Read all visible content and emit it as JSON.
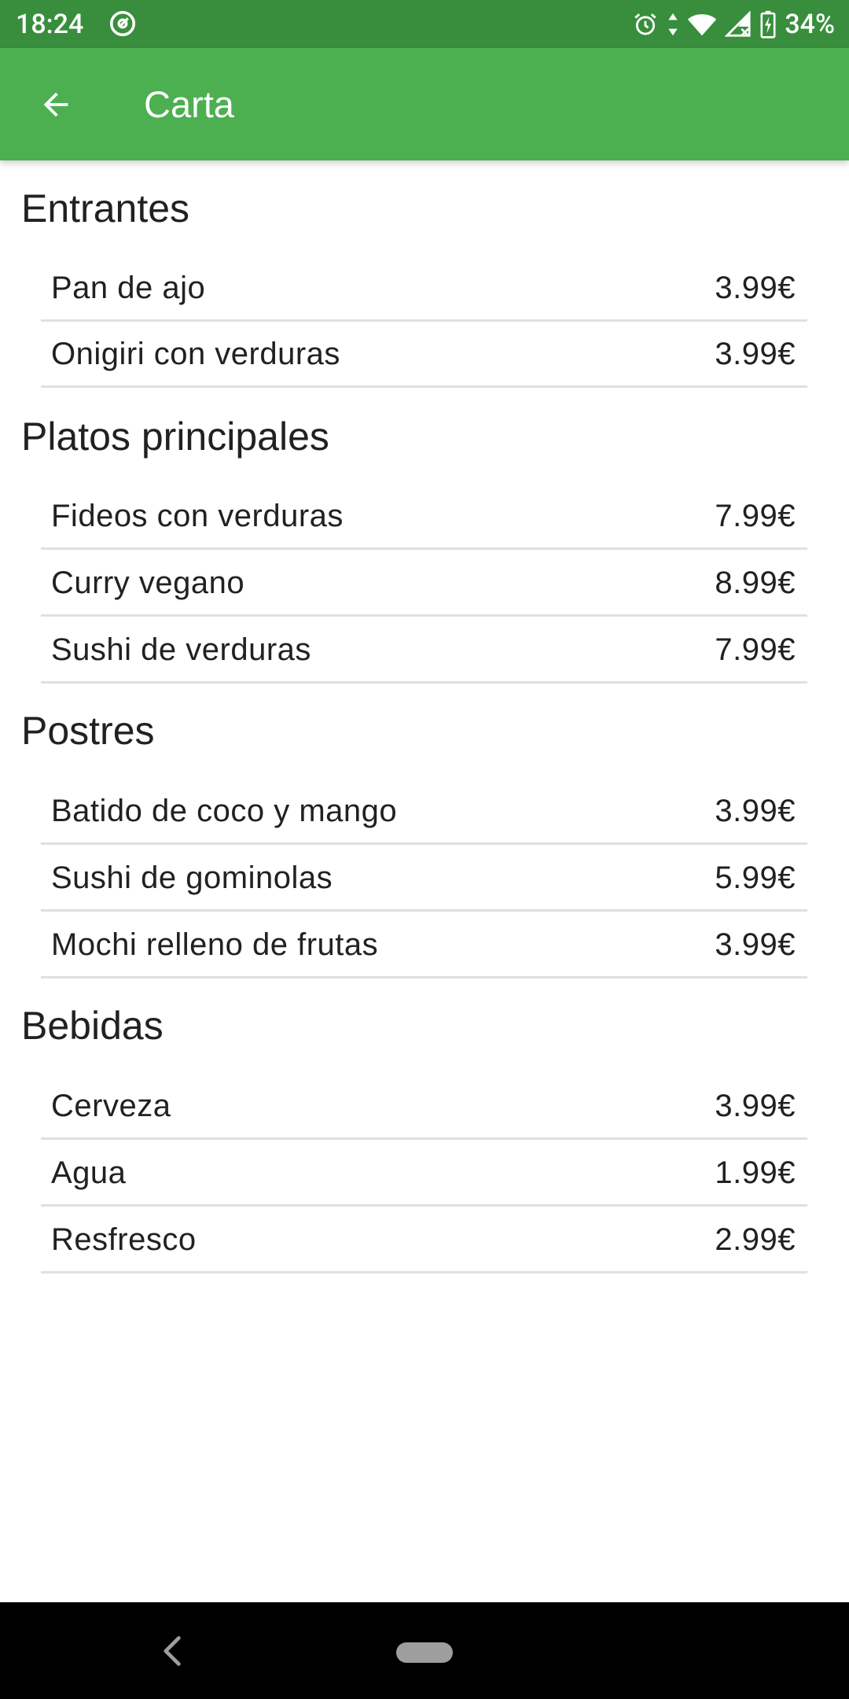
{
  "status_bar": {
    "time": "18:24",
    "battery": "34%",
    "icons": [
      "at-sign-icon",
      "alarm-icon",
      "data-arrows-icon",
      "wifi-icon",
      "signal-icon",
      "battery-charging-icon"
    ]
  },
  "app_bar": {
    "title": "Carta",
    "back_icon": "arrow-back-icon"
  },
  "menu": [
    {
      "title": "Entrantes",
      "items": [
        {
          "name": "Pan de ajo",
          "price": "3.99€"
        },
        {
          "name": "Onigiri con verduras",
          "price": "3.99€"
        }
      ]
    },
    {
      "title": "Platos principales",
      "items": [
        {
          "name": "Fideos con verduras",
          "price": "7.99€"
        },
        {
          "name": "Curry vegano",
          "price": "8.99€"
        },
        {
          "name": "Sushi de verduras",
          "price": "7.99€"
        }
      ]
    },
    {
      "title": "Postres",
      "items": [
        {
          "name": "Batido de coco y mango",
          "price": "3.99€"
        },
        {
          "name": "Sushi de gominolas",
          "price": "5.99€"
        },
        {
          "name": "Mochi relleno de frutas",
          "price": "3.99€"
        }
      ]
    },
    {
      "title": "Bebidas",
      "items": [
        {
          "name": "Cerveza",
          "price": "3.99€"
        },
        {
          "name": "Agua",
          "price": "1.99€"
        },
        {
          "name": "Resfresco",
          "price": "2.99€"
        }
      ]
    }
  ],
  "nav_bar": {
    "back_icon": "nav-back-icon",
    "home_icon": "home-pill-icon"
  },
  "colors": {
    "status_bar": "#388e3c",
    "app_bar": "#4caf50",
    "text": "#212121",
    "divider": "#e0e0e0"
  }
}
